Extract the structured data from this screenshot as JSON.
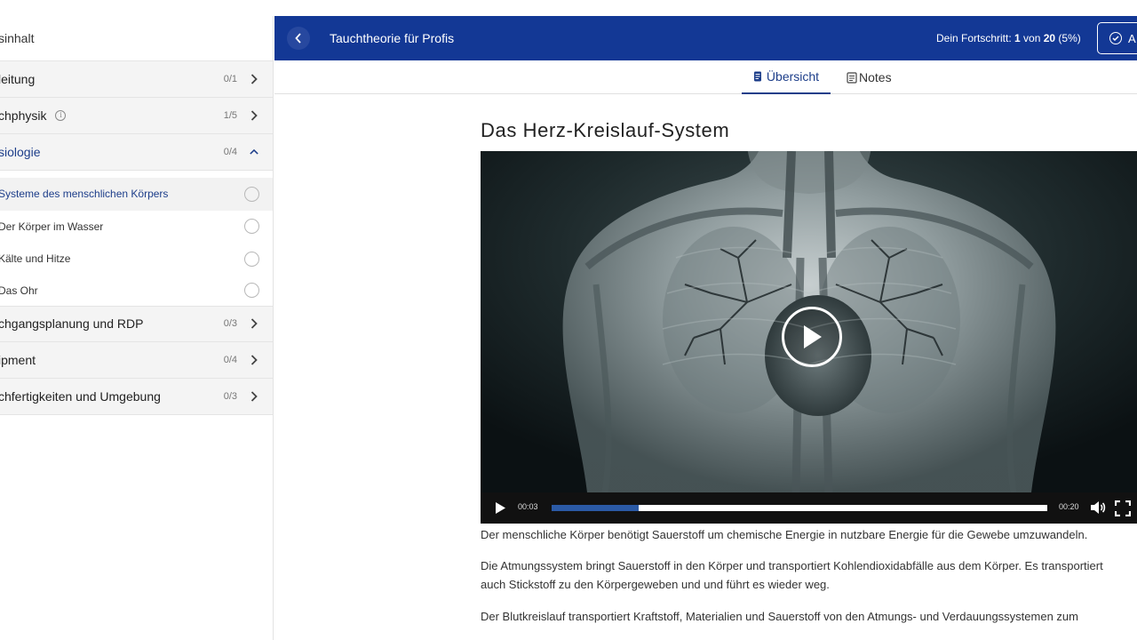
{
  "sidebar": {
    "header": "sinhalt",
    "chapters": [
      {
        "title": "leitung",
        "count": "0/1",
        "open": false
      },
      {
        "title": "chphysik",
        "count": "1/5",
        "open": false,
        "info": true
      },
      {
        "title": "siologie",
        "count": "0/4",
        "open": true
      },
      {
        "title": "chgangsplanung und RDP",
        "count": "0/3",
        "open": false
      },
      {
        "title": "ipment",
        "count": "0/4",
        "open": false
      },
      {
        "title": "chfertigkeiten und Umgebung",
        "count": "0/3",
        "open": false
      }
    ],
    "lessons": [
      {
        "title": "Systeme des menschlichen Körpers",
        "active": true
      },
      {
        "title": "Der Körper im Wasser",
        "active": false
      },
      {
        "title": "Kälte und Hitze",
        "active": false
      },
      {
        "title": "Das Ohr",
        "active": false
      }
    ]
  },
  "topbar": {
    "course_title": "Tauchtheorie für Profis",
    "progress_prefix": "Dein Fortschritt: ",
    "progress_current": "1",
    "progress_of": " von ",
    "progress_total": "20",
    "progress_percent": " (5%)",
    "complete_label": "A"
  },
  "tabs": {
    "overview": "Übersicht",
    "notes": "Notes"
  },
  "content": {
    "title": "Das Herz-Kreislauf-System",
    "video": {
      "current_time": "00:03",
      "duration": "00:20",
      "progress_fraction": 0.175
    },
    "paragraphs": [
      "Der menschliche Körper benötigt Sauerstoff um chemische Energie in nutzbare Energie für die Gewebe umzuwandeln.",
      "Die Atmungssystem bringt Sauerstoff in den Körper und transportiert Kohlendioxidabfälle aus dem Körper. Es transportiert",
      "auch Stickstoff zu den Körpergeweben und und führt es wieder weg.",
      "Der Blutkreislauf transportiert Kraftstoff, Materialien und Sauerstoff von den Atmungs- und Verdauungssystemen zum"
    ]
  }
}
